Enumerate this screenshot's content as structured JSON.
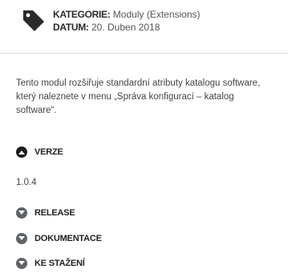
{
  "meta": {
    "icon": "tag-icon",
    "category_key": "KATEGORIE:",
    "category_value": "Moduly (Extensions)",
    "date_key": "DATUM:",
    "date_value": "20. Duben 2018"
  },
  "description": {
    "line1": "Tento modul rozšiřuje standardní atributy katalogu software,",
    "line2": "který naleznete v menu „Správa konfigurací – katalog",
    "line3": "software“."
  },
  "sections": {
    "verze": {
      "label": "VERZE",
      "icon": "chevron-up-icon",
      "expanded": true,
      "content": "1.0.4"
    },
    "release": {
      "label": "RELEASE",
      "icon": "chevron-down-icon",
      "expanded": false
    },
    "dokumentace": {
      "label": "DOKUMENTACE",
      "icon": "chevron-down-icon",
      "expanded": false
    },
    "ke_stazeni": {
      "label": "KE STAŽENÍ",
      "icon": "chevron-down-icon",
      "expanded": false
    }
  },
  "colors": {
    "expanded_toggle": "#1e1e1e",
    "collapsed_toggle": "#5f6368",
    "divider": "#dddddd"
  }
}
